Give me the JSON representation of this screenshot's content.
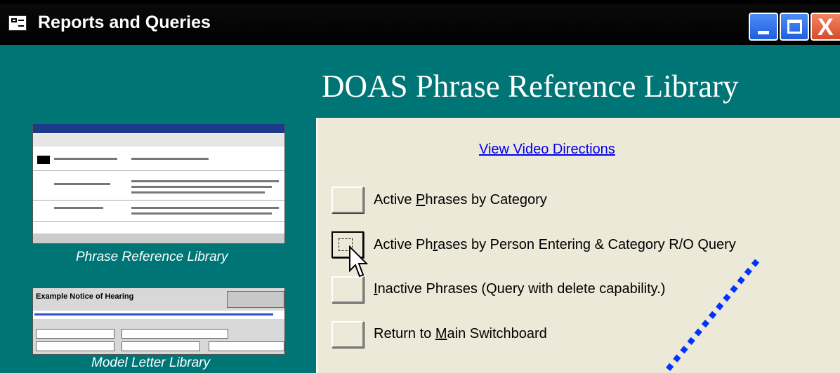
{
  "window": {
    "title": "Reports and Queries",
    "controls": [
      "minimize",
      "maximize",
      "close"
    ],
    "close_glyph": "X"
  },
  "header": {
    "title": "DOAS Phrase Reference Library"
  },
  "panel": {
    "link": "View Video Directions",
    "buttons": [
      {
        "pre": "Active ",
        "key": "P",
        "post": "hrases by Category"
      },
      {
        "pre": "Active Ph",
        "key": "r",
        "post": "ases by Person Entering & Category R/O Query"
      },
      {
        "pre": "",
        "key": "I",
        "post": "nactive Phrases (Query with delete capability.)"
      },
      {
        "pre": "Return to ",
        "key": "M",
        "post": "ain Switchboard"
      }
    ]
  },
  "thumbnails": [
    {
      "caption": "Phrase Reference Library"
    },
    {
      "caption": "Model Letter Library",
      "heading": "Example Notice of Hearing"
    }
  ],
  "colors": {
    "background": "#007575",
    "panel": "#ece9d8",
    "link": "#0000ee",
    "dots": "#0033ff"
  }
}
